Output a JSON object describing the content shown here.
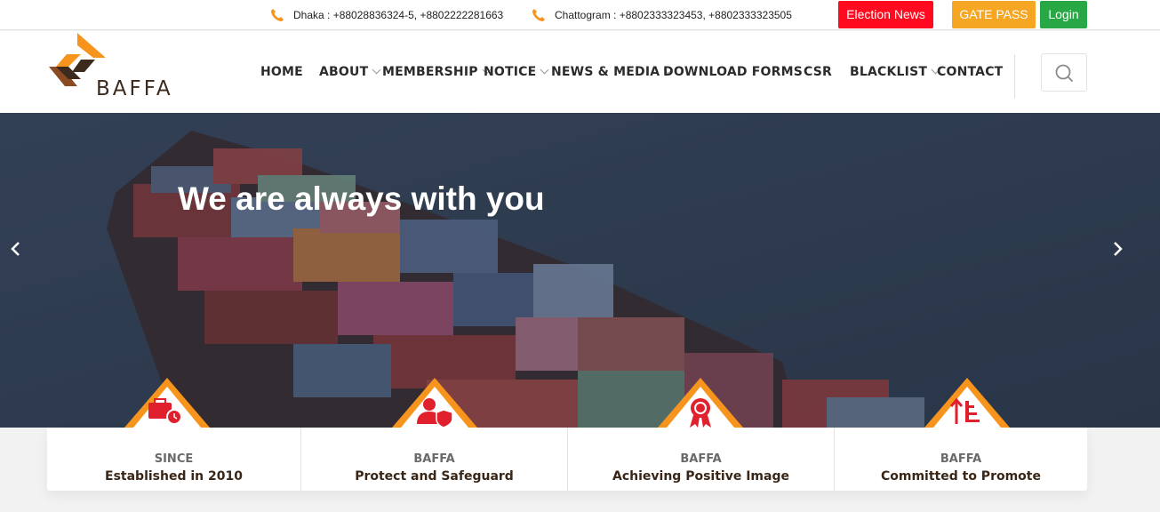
{
  "topbar": {
    "contacts": [
      {
        "icon": "phone-icon",
        "text": "Dhaka : +88028836324-5, +8802222281663"
      },
      {
        "icon": "phone-icon",
        "text": "Chattogram : +8802333323453, +8802333323505"
      }
    ],
    "buttons": {
      "election": "Election News",
      "gate_pass": "GATE PASS",
      "login": "Login"
    }
  },
  "brand": {
    "name": "BAFFA"
  },
  "nav": [
    {
      "label": "HOME",
      "dropdown": false
    },
    {
      "label": "ABOUT",
      "dropdown": true
    },
    {
      "label": "MEMBERSHIP",
      "dropdown": true
    },
    {
      "label": "NOTICE",
      "dropdown": true
    },
    {
      "label": "NEWS & MEDIA",
      "dropdown": true
    },
    {
      "label": "DOWNLOAD FORMS",
      "dropdown": false
    },
    {
      "label": "CSR",
      "dropdown": false
    },
    {
      "label": "BLACKLIST",
      "dropdown": true
    },
    {
      "label": "CONTACT",
      "dropdown": false
    }
  ],
  "hero": {
    "title": "We are always with you"
  },
  "features": [
    {
      "icon": "toolbox-clock-icon",
      "label": "SINCE",
      "title": "Established in 2010"
    },
    {
      "icon": "user-shield-icon",
      "label": "BAFFA",
      "title": "Protect and Safeguard"
    },
    {
      "icon": "award-ribbon-icon",
      "label": "BAFFA",
      "title": "Achieving Positive Image"
    },
    {
      "icon": "sort-ascending-icon",
      "label": "BAFFA",
      "title": "Committed to Promote"
    }
  ],
  "colors": {
    "election": "#ff0a1e",
    "gate_pass": "#f5a623",
    "login": "#28a745",
    "accent_orange": "#f7941d",
    "icon_red": "#e0202c",
    "brand_brown": "#3c2a1c"
  }
}
